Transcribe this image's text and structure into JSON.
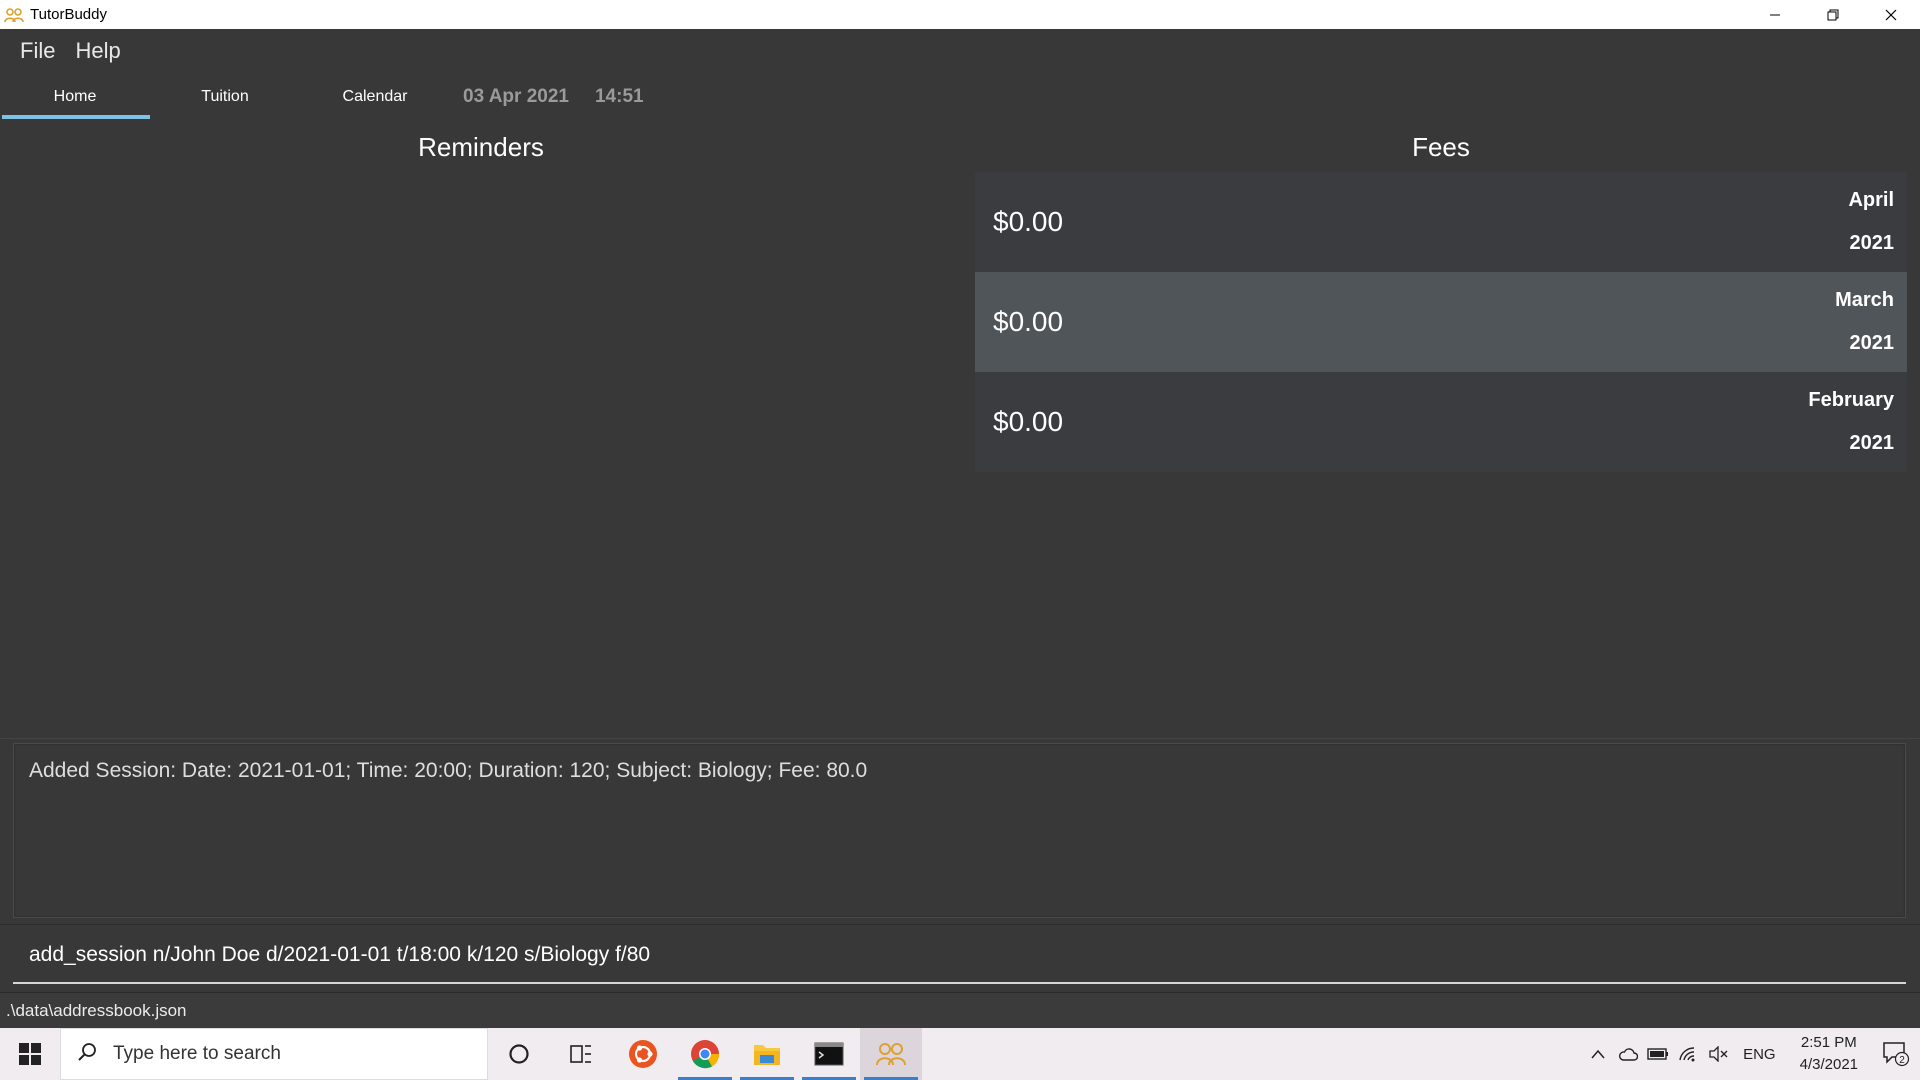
{
  "window": {
    "title": "TutorBuddy",
    "controls": {
      "minimize": "—",
      "restore": "❐",
      "close": "✕"
    }
  },
  "menu": {
    "items": [
      "File",
      "Help"
    ]
  },
  "tabs": {
    "items": [
      "Home",
      "Tuition",
      "Calendar"
    ],
    "active": "Home",
    "date": "03 Apr 2021",
    "time": "14:51"
  },
  "reminders": {
    "title": "Reminders"
  },
  "fees": {
    "title": "Fees",
    "rows": [
      {
        "amount": "$0.00",
        "month": "April",
        "year": "2021"
      },
      {
        "amount": "$0.00",
        "month": "March",
        "year": "2021"
      },
      {
        "amount": "$0.00",
        "month": "February",
        "year": "2021"
      }
    ]
  },
  "result": {
    "text": "Added Session: Date: 2021-01-01; Time: 20:00; Duration: 120; Subject: Biology; Fee: 80.0"
  },
  "command": {
    "value": "add_session n/John Doe d/2021-01-01 t/18:00 k/120 s/Biology f/80"
  },
  "status": {
    "path": ".\\data\\addressbook.json"
  },
  "taskbar": {
    "search_placeholder": "Type here to search",
    "apps": [
      "cortana-icon",
      "task-view-icon",
      "ubuntu-icon",
      "chrome-icon",
      "file-explorer-icon",
      "terminal-icon",
      "tutorbuddy-icon"
    ],
    "language": "ENG",
    "clock_time": "2:51 PM",
    "clock_date": "4/3/2021",
    "notification_count": "2"
  },
  "colors": {
    "accent": "#7ec3e6",
    "background": "#383838",
    "selected_row": "#505559"
  }
}
